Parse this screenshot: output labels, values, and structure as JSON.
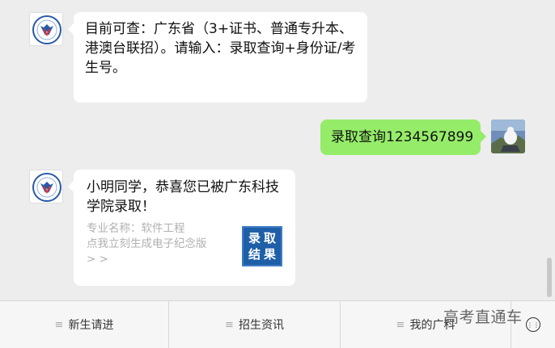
{
  "messages": {
    "bot_intro": "目前可查：广东省（3+证书、普通专升本、港澳台联招）。请输入：录取查询+身份证/考生号。",
    "user_query": "录取查询1234567899",
    "result_card": {
      "title": "小明同学，恭喜您已被广东科技学院录取！",
      "major_line": "专业名称：软件工程",
      "cta_line": "点我立刻生成电子纪念版",
      "arrows": "> >",
      "badge_chars": [
        "录",
        "取",
        "结",
        "果"
      ]
    }
  },
  "bottom_menu": {
    "items": [
      "新生请进",
      "招生资讯",
      "我的广科"
    ],
    "menu_glyph": "≡",
    "keyboard_icon": "keyboard-icon"
  },
  "watermark": "高考直通车",
  "colors": {
    "background": "#ededed",
    "bubble_white": "#ffffff",
    "bubble_green": "#95ec69",
    "badge_blue": "#1f5fa8",
    "secondary_text": "#b0b0b0"
  }
}
